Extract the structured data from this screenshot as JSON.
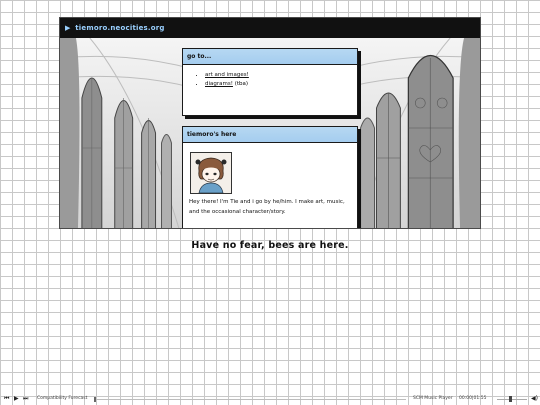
{
  "site": {
    "title": "tiemoro.neocities.org"
  },
  "goto": {
    "heading": "go to...",
    "links": [
      {
        "text": "art and images!",
        "note": ""
      },
      {
        "text": "diagrams!",
        "note": " (tba)"
      }
    ]
  },
  "about": {
    "heading": "tiemoro's here",
    "text": "Hey there! I'm Tie and i go by he/him. I make art, music, and the occasional character/story."
  },
  "caption": "Have no fear, bees are here.",
  "player": {
    "prev_icon": "skip-back-icon",
    "play_icon": "play-icon",
    "next_icon": "skip-forward-icon",
    "track": "Compatibility Forecast",
    "name": "SCM Music Player",
    "time": "00:00|01:55",
    "progress": 0,
    "volume": 0.4
  },
  "colors": {
    "topbar": "#111111",
    "title": "#9ad0ff",
    "panel_head": "#a5cdef",
    "grid": "#c8c8c8"
  }
}
